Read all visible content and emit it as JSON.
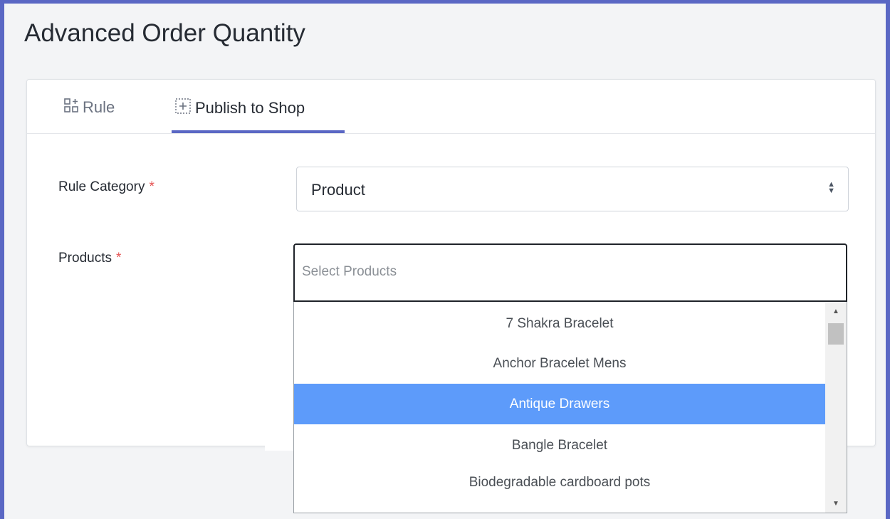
{
  "page": {
    "title": "Advanced Order Quantity"
  },
  "tabs": [
    {
      "label": "Rule",
      "icon": "grid-plus-icon"
    },
    {
      "label": "Publish to Shop",
      "icon": "dashed-plus-box-icon"
    }
  ],
  "form": {
    "rule_category": {
      "label": "Rule Category",
      "required_mark": "*",
      "value": "Product"
    },
    "products": {
      "label": "Products",
      "required_mark": "*",
      "placeholder": "Select Products"
    }
  },
  "dropdown": {
    "options": [
      "7 Shakra Bracelet",
      "Anchor Bracelet Mens",
      "Antique Drawers",
      "Bangle Bracelet",
      "Biodegradable cardboard pots"
    ],
    "highlighted": "Antique Drawers"
  },
  "colors": {
    "accent": "#5a67c4",
    "highlight": "#5d9bfa",
    "required": "#e55353"
  }
}
